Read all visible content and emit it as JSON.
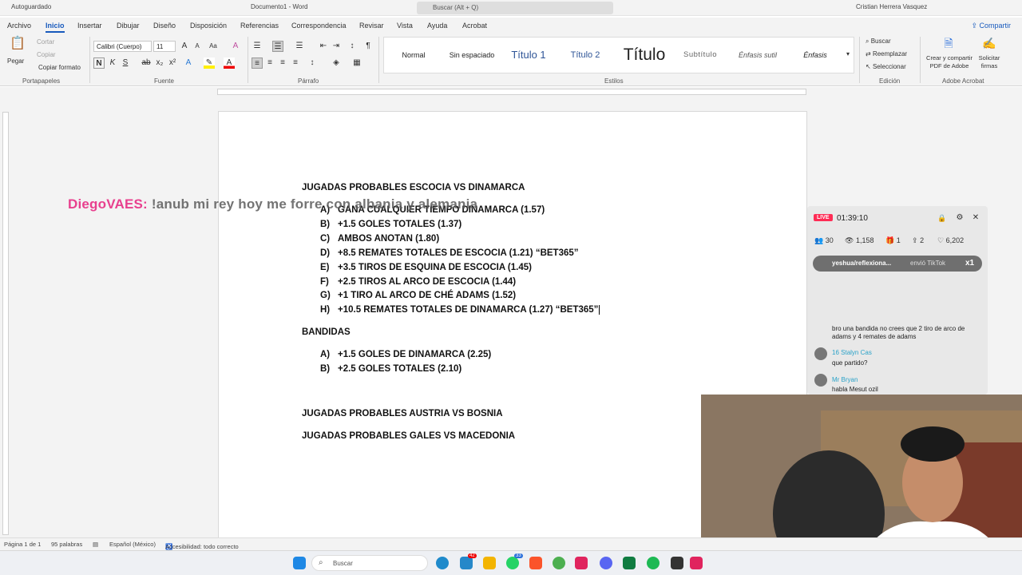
{
  "titlebar": {
    "autosave": "Autoguardado",
    "doc_title": "Documento1 - Word",
    "search_placeholder": "Buscar (Alt + Q)",
    "user": "Cristian Herrera Vasquez"
  },
  "tabs": [
    "Archivo",
    "Inicio",
    "Insertar",
    "Dibujar",
    "Diseño",
    "Disposición",
    "Referencias",
    "Correspondencia",
    "Revisar",
    "Vista",
    "Ayuda",
    "Acrobat"
  ],
  "share_label": "Compartir",
  "ribbon": {
    "clipboard": {
      "paste": "Pegar",
      "cut": "Cortar",
      "copy": "Copiar",
      "format_painter": "Copiar formato",
      "label": "Portapapeles"
    },
    "font": {
      "name": "Calibri (Cuerpo)",
      "size": "11",
      "label": "Fuente"
    },
    "paragraph": {
      "label": "Párrafo"
    },
    "styles": {
      "items": [
        "Normal",
        "Sin espaciado",
        "Título 1",
        "Título 2",
        "Título",
        "Subtítulo",
        "Énfasis sutil",
        "Énfasis"
      ],
      "label": "Estilos"
    },
    "editing": {
      "find": "Buscar",
      "replace": "Reemplazar",
      "select": "Seleccionar",
      "label": "Edición"
    },
    "adobe": {
      "create": "Crear y compartir PDF de Adobe",
      "request": "Solicitar firmas",
      "label": "Adobe Acrobat"
    }
  },
  "document": {
    "heading1": "JUGADAS PROBABLES ESCOCIA VS DINAMARCA",
    "list1": [
      {
        "marker": "A)",
        "text": "GANA CUALQUIER TIEMPO DINAMARCA (1.57)"
      },
      {
        "marker": "B)",
        "text": "+1.5 GOLES TOTALES (1.37)"
      },
      {
        "marker": "C)",
        "text": "AMBOS ANOTAN (1.80)"
      },
      {
        "marker": "D)",
        "text": "+8.5 REMATES TOTALES DE ESCOCIA (1.21) “BET365”"
      },
      {
        "marker": "E)",
        "text": "+3.5 TIROS DE ESQUINA DE ESCOCIA (1.45)"
      },
      {
        "marker": "F)",
        "text": "+2.5 TIROS AL ARCO DE ESCOCIA (1.44)"
      },
      {
        "marker": "G)",
        "text": "+1 TIRO AL ARCO DE CHÉ ADAMS (1.52)"
      },
      {
        "marker": "H)",
        "text": "+10.5 REMATES TOTALES DE DINAMARCA (1.27) “BET365”"
      }
    ],
    "heading2": "BANDIDAS",
    "list2": [
      {
        "marker": "A)",
        "text": "+1.5 GOLES DE DINAMARCA (2.25)"
      },
      {
        "marker": "B)",
        "text": "+2.5 GOLES TOTALES (2.10)"
      }
    ],
    "heading3": "JUGADAS PROBABLES AUSTRIA VS BOSNIA",
    "heading4": "JUGADAS PROBABLES GALES VS MACEDONIA"
  },
  "status": {
    "page": "Página 1 de 1",
    "words": "95 palabras",
    "language": "Español (México)",
    "accessibility": "Accesibilidad: todo correcto"
  },
  "taskbar": {
    "search": "Buscar",
    "badge1": "42",
    "badge2": "33"
  },
  "overlay": {
    "user": "DiegoVAES:",
    "message": "!anub mi rey hoy me forre con albania y alemania"
  },
  "live": {
    "badge": "LIVE",
    "time": "01:39:10",
    "stats": [
      "30",
      "1,158",
      "1",
      "2",
      "6,202"
    ],
    "gift": {
      "text": "yeshua/reflexiona...",
      "action": "envió TikTok",
      "count": "x1"
    },
    "chat": [
      {
        "user": "",
        "text": "bro una bandida no crees que 2 tiro de arco de adams y 4 remates de adams"
      },
      {
        "user": "Stalyn Cas",
        "level": "16",
        "text": "que partido?"
      },
      {
        "user": "Mr Bryan",
        "text": "habla Mesut ozil"
      }
    ]
  },
  "colors": {
    "accent": "#185abd",
    "overlay_user": "#e8408e",
    "live": "#fe2c55"
  }
}
